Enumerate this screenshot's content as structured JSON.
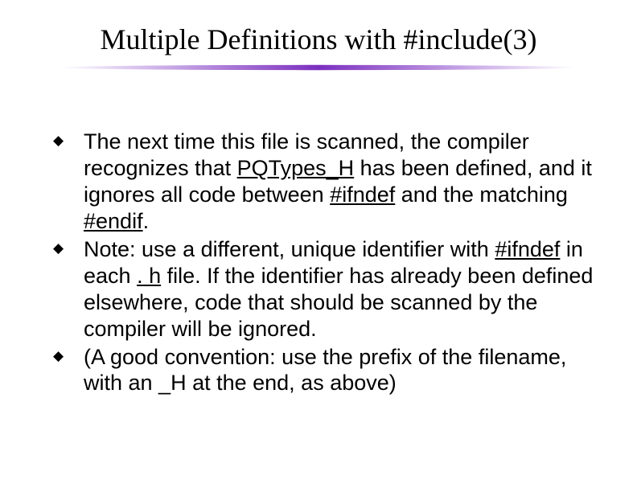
{
  "title": "Multiple Definitions with #include(3)",
  "bullets": [
    {
      "pre1": "The next time this file is scanned, the compiler recognizes that ",
      "u1": "PQTypes_H",
      "mid1": " has been defined, and it ignores all code between ",
      "u2": "#ifndef",
      "mid2": " and the matching ",
      "u3": "#endif",
      "post": "."
    },
    {
      "pre1": "Note: use a different, unique identifier with ",
      "u1": "#ifndef",
      "mid1": " in each ",
      "u2": ". h",
      "post": " file. If the identifier has already been defined elsewhere, code that should be scanned by the compiler will be ignored."
    },
    {
      "text": "(A good convention: use the prefix of the filename, with an _H at the end, as above)"
    }
  ]
}
